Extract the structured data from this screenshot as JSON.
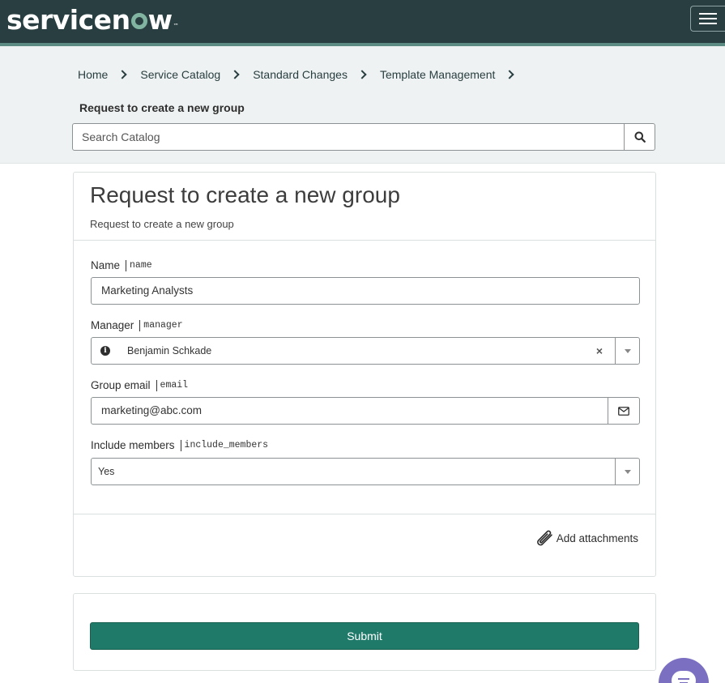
{
  "header": {
    "logo_text_1": "servicen",
    "logo_text_2": "w",
    "logo_tm": "™",
    "menu_icon": "hamburger-icon"
  },
  "breadcrumb": {
    "items": [
      "Home",
      "Service Catalog",
      "Standard Changes",
      "Template Management"
    ],
    "current": "Request to create a new group"
  },
  "search": {
    "placeholder": "Search Catalog",
    "icon": "search-icon"
  },
  "form": {
    "title": "Request to create a new group",
    "subtitle": "Request to create a new group",
    "fields": {
      "name": {
        "label": "Name",
        "var": "name",
        "value": "Marketing Analysts"
      },
      "manager": {
        "label": "Manager",
        "var": "manager",
        "value": "Benjamin Schkade",
        "info_icon": "i",
        "clear_icon": "×"
      },
      "email": {
        "label": "Group email",
        "var": "email",
        "value": "marketing@abc.com"
      },
      "include_members": {
        "label": "Include members",
        "var": "include_members",
        "value": "Yes"
      }
    },
    "attachments_label": "Add attachments"
  },
  "submit": {
    "label": "Submit"
  },
  "colors": {
    "header_bg": "#293e40",
    "accent": "#81b5a1",
    "submit_bg": "#1f7a6a",
    "chat_bg": "#7b6fc2"
  }
}
